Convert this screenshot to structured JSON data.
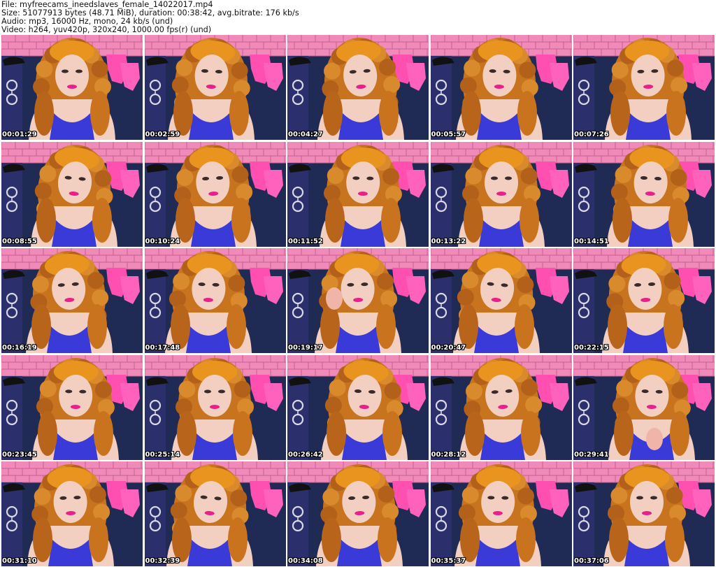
{
  "header": {
    "file_line": "File: myfreecams_ineedslaves_female_14022017.mp4",
    "size_line": "Size: 51077913 bytes (48.71 MiB), duration: 00:38:42, avg.bitrate: 176 kb/s",
    "audio_line": "Audio: mp3, 16000 Hz, mono, 24 kb/s (und)",
    "video_line": "Video: h264, yuv420p, 320x240, 1000.00 fps(r) (und)"
  },
  "thumbnails": [
    {
      "timestamp": "00:01:29"
    },
    {
      "timestamp": "00:02:59"
    },
    {
      "timestamp": "00:04:27"
    },
    {
      "timestamp": "00:05:57"
    },
    {
      "timestamp": "00:07:26"
    },
    {
      "timestamp": "00:08:55"
    },
    {
      "timestamp": "00:10:24"
    },
    {
      "timestamp": "00:11:52"
    },
    {
      "timestamp": "00:13:22"
    },
    {
      "timestamp": "00:14:51"
    },
    {
      "timestamp": "00:16:19"
    },
    {
      "timestamp": "00:17:48"
    },
    {
      "timestamp": "00:19:17"
    },
    {
      "timestamp": "00:20:47"
    },
    {
      "timestamp": "00:22:15"
    },
    {
      "timestamp": "00:23:45"
    },
    {
      "timestamp": "00:25:14"
    },
    {
      "timestamp": "00:26:42"
    },
    {
      "timestamp": "00:28:12"
    },
    {
      "timestamp": "00:29:41"
    },
    {
      "timestamp": "00:31:10"
    },
    {
      "timestamp": "00:32:39"
    },
    {
      "timestamp": "00:34:08"
    },
    {
      "timestamp": "00:35:37"
    },
    {
      "timestamp": "00:37:06"
    }
  ],
  "colors": {
    "brick_wall": "#f08ab8",
    "backdrop": "#1f2a55",
    "hair": "#c8741e",
    "dress": "#3a3ad8",
    "skin": "#f2cfc0",
    "gloves": "#ff4fb0",
    "lips": "#e8208c",
    "timestamp_text": "#ffffff"
  }
}
